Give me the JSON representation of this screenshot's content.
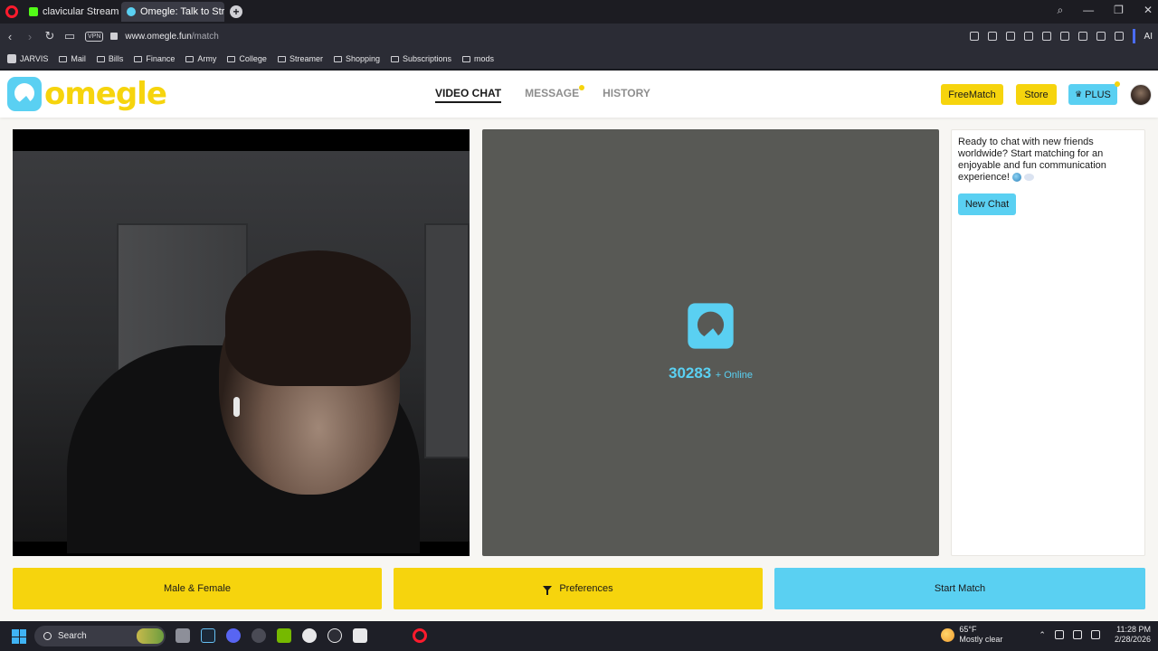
{
  "browser": {
    "tabs": [
      {
        "label": "clavicular Stream - Watch",
        "active": false
      },
      {
        "label": "Omegle: Talk to Strangers",
        "active": true
      }
    ],
    "vpn_label": "VPN",
    "url_host": "www.omegle.fun",
    "url_path": "/match",
    "ai_label": "AI",
    "bookmarks": [
      "JARVIS",
      "Mail",
      "Bills",
      "Finance",
      "Army",
      "College",
      "Streamer",
      "Shopping",
      "Subscriptions",
      "mods"
    ]
  },
  "site": {
    "logo_text": "omegle",
    "nav": [
      {
        "label": "VIDEO CHAT",
        "active": true
      },
      {
        "label": "MESSAGE",
        "active": false,
        "has_dot": true
      },
      {
        "label": "HISTORY",
        "active": false
      }
    ],
    "header_buttons": {
      "freematch": "FreeMatch",
      "store": "Store",
      "plus": "PLUS"
    },
    "remote": {
      "online_count": "30283",
      "online_label": "+ Online"
    },
    "side_panel": {
      "message": "Ready to chat with new friends worldwide? Start matching for an enjoyable and fun communication experience!",
      "new_chat_label": "New Chat"
    },
    "bottom_buttons": {
      "gender": "Male & Female",
      "preferences": "Preferences",
      "start": "Start Match"
    }
  },
  "taskbar": {
    "search_placeholder": "Search",
    "weather_temp": "65°F",
    "weather_desc": "Mostly clear",
    "time": "11:28 PM",
    "date": "2/28/2026"
  },
  "colors": {
    "brand_yellow": "#f6d40d",
    "brand_blue": "#5ad0f2",
    "remote_bg": "#585955"
  }
}
